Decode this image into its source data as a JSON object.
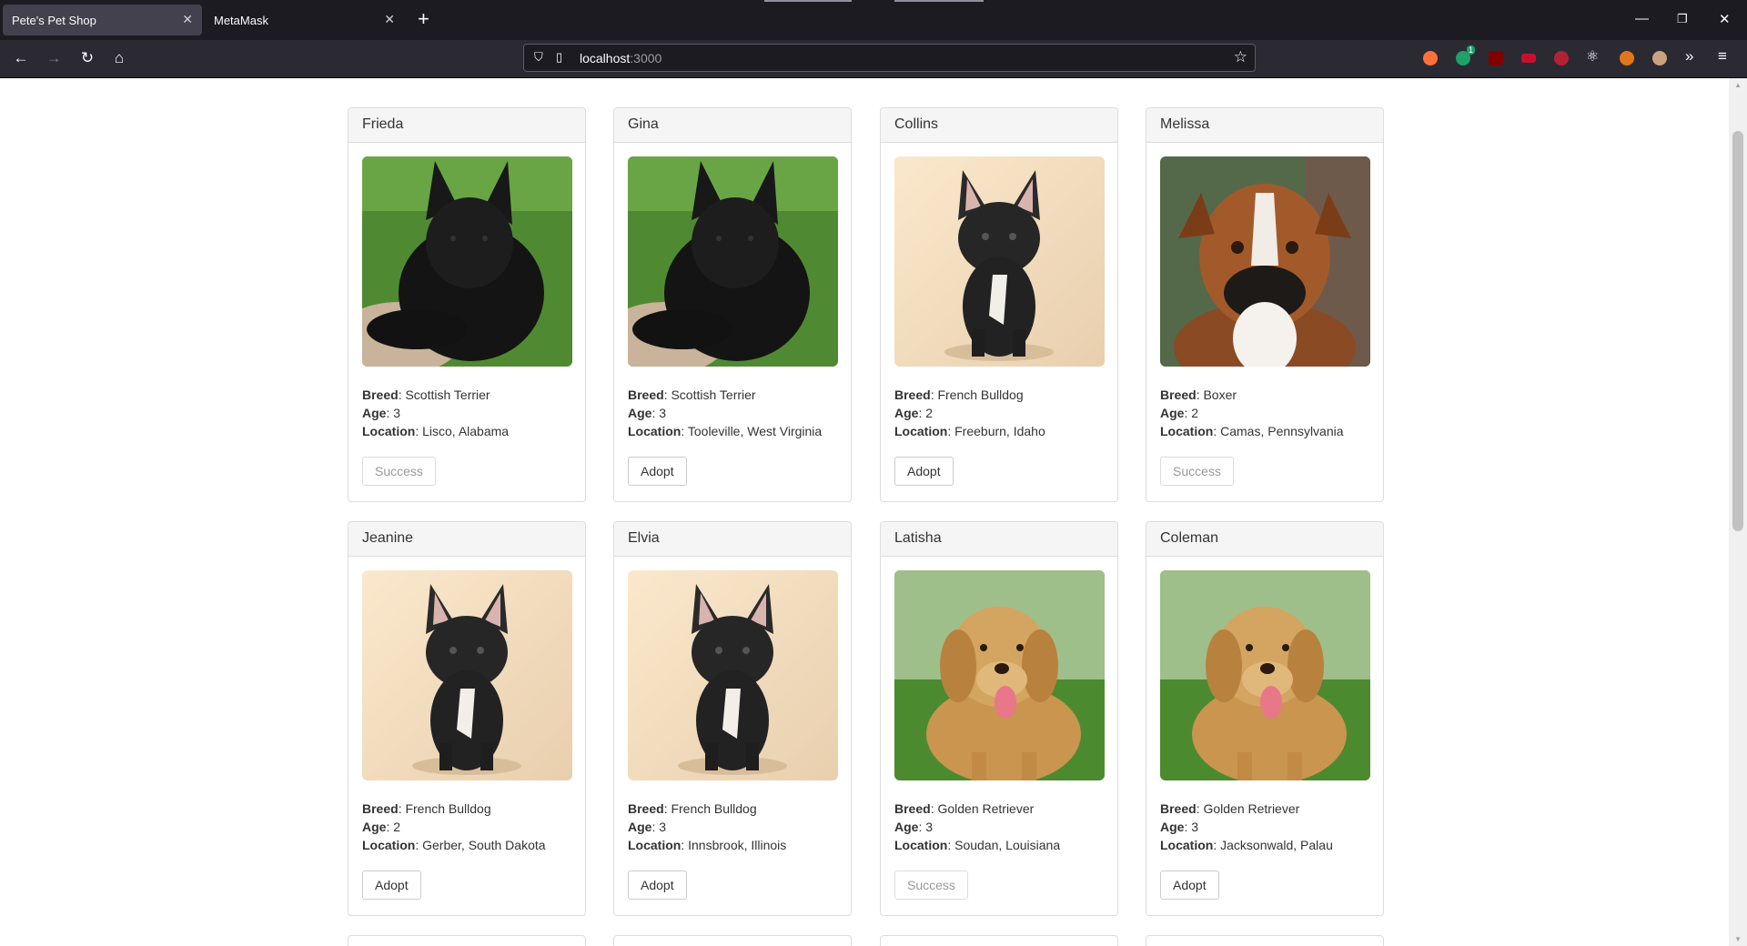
{
  "browser": {
    "tabs": [
      {
        "title": "Pete's Pet Shop",
        "active": true
      },
      {
        "title": "MetaMask",
        "active": false
      }
    ],
    "url_host": "localhost",
    "url_port": ":3000",
    "extension_badge": "1"
  },
  "labels": {
    "breed": "Breed",
    "age": "Age",
    "location": "Location"
  },
  "pets": [
    {
      "name": "Frieda",
      "breed": "Scottish Terrier",
      "age": "3",
      "location": "Lisco, Alabama",
      "button": "Success",
      "adopted": true,
      "photo": "scottish-terrier"
    },
    {
      "name": "Gina",
      "breed": "Scottish Terrier",
      "age": "3",
      "location": "Tooleville, West Virginia",
      "button": "Adopt",
      "adopted": false,
      "photo": "scottish-terrier"
    },
    {
      "name": "Collins",
      "breed": "French Bulldog",
      "age": "2",
      "location": "Freeburn, Idaho",
      "button": "Adopt",
      "adopted": false,
      "photo": "french-bulldog"
    },
    {
      "name": "Melissa",
      "breed": "Boxer",
      "age": "2",
      "location": "Camas, Pennsylvania",
      "button": "Success",
      "adopted": true,
      "photo": "boxer"
    },
    {
      "name": "Jeanine",
      "breed": "French Bulldog",
      "age": "2",
      "location": "Gerber, South Dakota",
      "button": "Adopt",
      "adopted": false,
      "photo": "french-bulldog"
    },
    {
      "name": "Elvia",
      "breed": "French Bulldog",
      "age": "3",
      "location": "Innsbrook, Illinois",
      "button": "Adopt",
      "adopted": false,
      "photo": "french-bulldog"
    },
    {
      "name": "Latisha",
      "breed": "Golden Retriever",
      "age": "3",
      "location": "Soudan, Louisiana",
      "button": "Success",
      "adopted": true,
      "photo": "golden-retriever"
    },
    {
      "name": "Coleman",
      "breed": "Golden Retriever",
      "age": "3",
      "location": "Jacksonwald, Palau",
      "button": "Adopt",
      "adopted": false,
      "photo": "golden-retriever"
    }
  ]
}
